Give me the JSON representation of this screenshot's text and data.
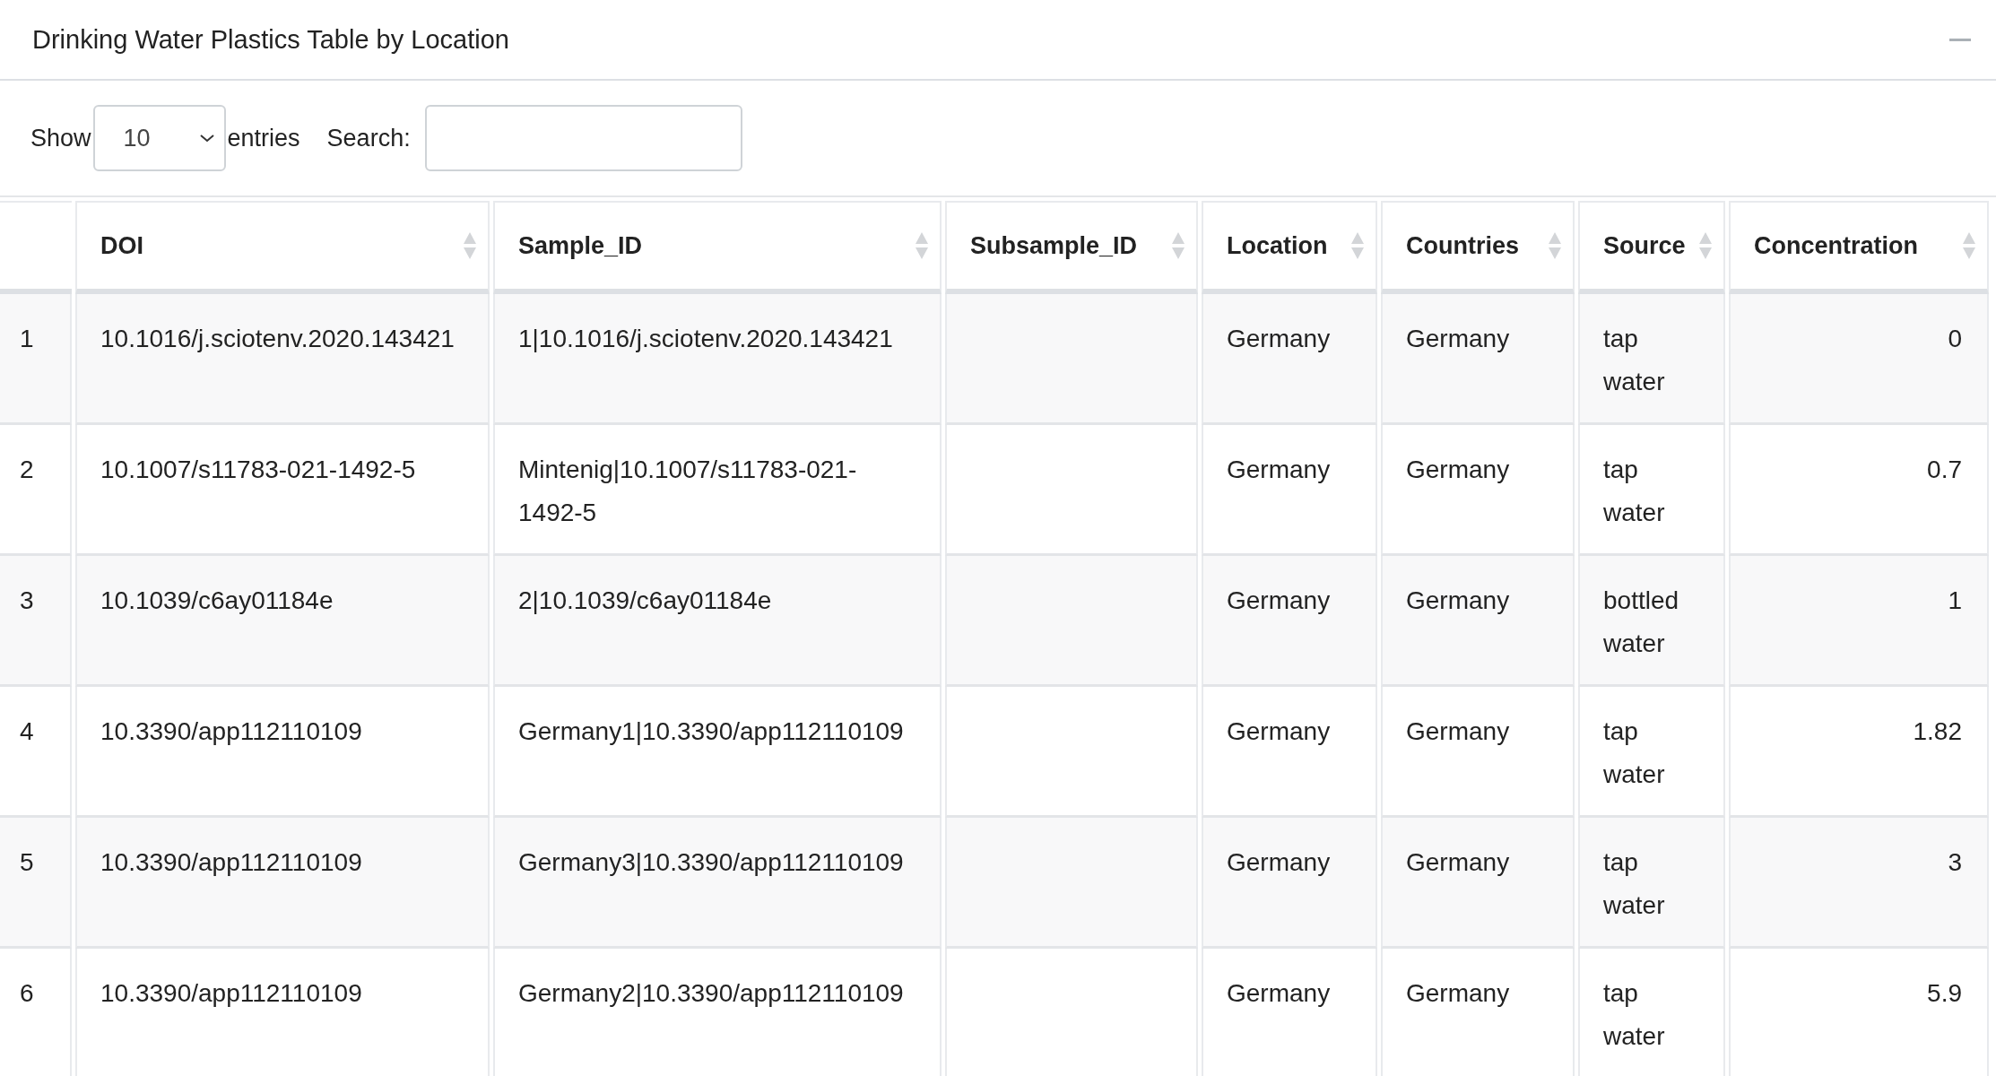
{
  "panel": {
    "title": "Drinking Water Plastics Table by Location",
    "collapsed": false
  },
  "length_menu": {
    "label_before": "Show",
    "value": "10",
    "label_after": "entries"
  },
  "search": {
    "label": "Search:"
  },
  "table": {
    "columns": [
      {
        "label": "DOI",
        "kind": "text"
      },
      {
        "label": "Sample_ID",
        "kind": "text"
      },
      {
        "label": "Subsample_ID",
        "kind": "text"
      },
      {
        "label": "Location",
        "kind": "text"
      },
      {
        "label": "Countries",
        "kind": "text"
      },
      {
        "label": "Source",
        "kind": "text"
      },
      {
        "label": "Concentration",
        "kind": "number"
      }
    ],
    "rows": [
      {
        "index": "1",
        "cells": [
          "10.1016/j.sciotenv.2020.143421",
          "1|10.1016/j.sciotenv.2020.143421",
          null,
          "Germany",
          "Germany",
          "tap water",
          "0"
        ]
      },
      {
        "index": "2",
        "cells": [
          "10.1007/s11783-021-1492-5",
          "Mintenig|10.1007/s11783-021-1492-5",
          null,
          "Germany",
          "Germany",
          "tap water",
          "0.7"
        ]
      },
      {
        "index": "3",
        "cells": [
          "10.1039/c6ay01184e",
          "2|10.1039/c6ay01184e",
          null,
          "Germany",
          "Germany",
          "bottled water",
          "1"
        ]
      },
      {
        "index": "4",
        "cells": [
          "10.3390/app112110109",
          "Germany1|10.3390/app112110109",
          null,
          "Germany",
          "Germany",
          "tap water",
          "1.82"
        ]
      },
      {
        "index": "5",
        "cells": [
          "10.3390/app112110109",
          "Germany3|10.3390/app112110109",
          null,
          "Germany",
          "Germany",
          "tap water",
          "3"
        ]
      },
      {
        "index": "6",
        "cells": [
          "10.3390/app112110109",
          "Germany2|10.3390/app112110109",
          null,
          "Germany",
          "Germany",
          "tap water",
          "5.9"
        ]
      }
    ]
  }
}
